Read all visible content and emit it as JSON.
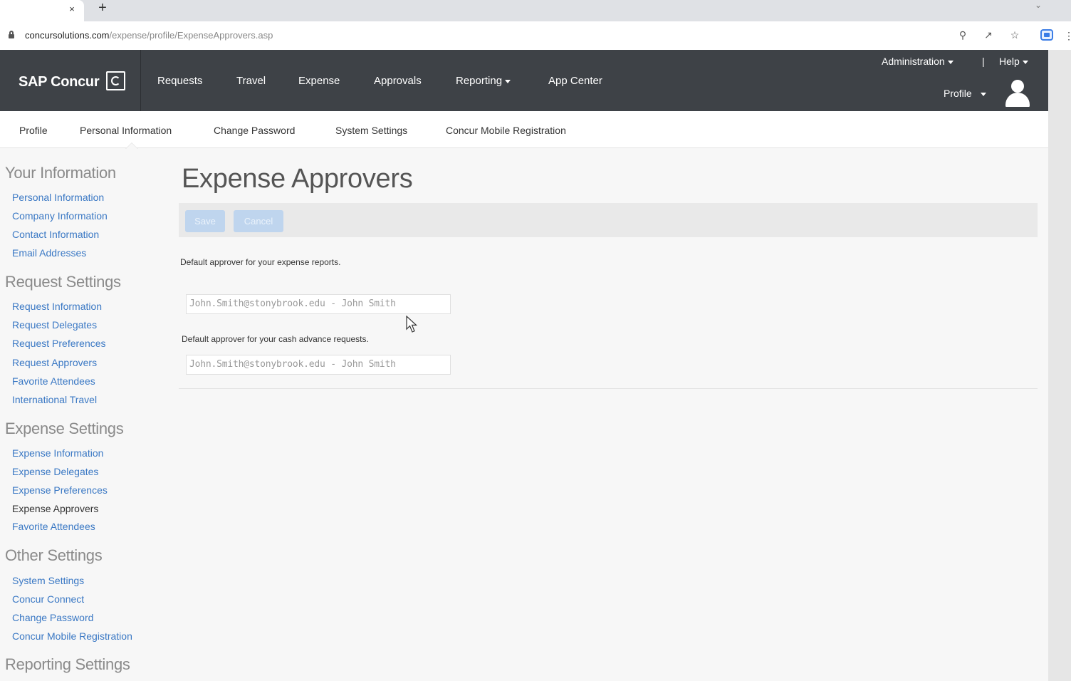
{
  "browser": {
    "tab_close": "×",
    "new_tab": "+",
    "url_host": "concursolutions.com",
    "url_path": "/expense/profile/ExpenseApprovers.asp"
  },
  "header": {
    "brand": "SAP Concur",
    "nav": [
      {
        "label": "Requests"
      },
      {
        "label": "Travel"
      },
      {
        "label": "Expense"
      },
      {
        "label": "Approvals"
      },
      {
        "label": "Reporting"
      },
      {
        "label": "App Center"
      }
    ],
    "administration": "Administration",
    "separator": "|",
    "help": "Help",
    "profile": "Profile"
  },
  "subnav": [
    {
      "label": "Profile"
    },
    {
      "label": "Personal Information"
    },
    {
      "label": "Change Password"
    },
    {
      "label": "System Settings"
    },
    {
      "label": "Concur Mobile Registration"
    }
  ],
  "sidebar": {
    "sections": [
      {
        "title": "Your Information",
        "links": [
          "Personal Information",
          "Company Information",
          "Contact Information",
          "Email Addresses"
        ]
      },
      {
        "title": "Request Settings",
        "links": [
          "Request Information",
          "Request Delegates",
          "Request Preferences",
          "Request Approvers",
          "Favorite Attendees",
          "International Travel"
        ]
      },
      {
        "title": "Expense Settings",
        "links": [
          "Expense Information",
          "Expense Delegates",
          "Expense Preferences",
          "Expense Approvers",
          "Favorite Attendees"
        ]
      },
      {
        "title": "Other Settings",
        "links": [
          "System Settings",
          "Concur Connect",
          "Change Password",
          "Concur Mobile Registration"
        ]
      },
      {
        "title": "Reporting Settings",
        "links": []
      }
    ],
    "active_link": "Expense Approvers"
  },
  "main": {
    "title": "Expense Approvers",
    "save_label": "Save",
    "cancel_label": "Cancel",
    "expense_label": "Default approver for your expense reports.",
    "expense_value": "John.Smith@stonybrook.edu - John Smith",
    "cash_label": "Default approver for your cash advance requests.",
    "cash_value": "John.Smith@stonybrook.edu - John Smith"
  }
}
